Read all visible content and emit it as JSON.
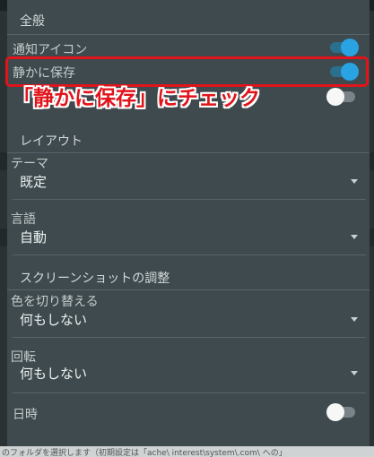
{
  "sections": {
    "general": "全般",
    "layout": "レイアウト",
    "screenshot_adjust": "スクリーンショットの調整"
  },
  "settings": {
    "notification_icon": {
      "label": "通知アイコン",
      "state": "on"
    },
    "silent_save": {
      "label": "静かに保存",
      "state": "on"
    },
    "theme": {
      "label": "テーマ",
      "value": "既定"
    },
    "language": {
      "label": "言語",
      "value": "自動"
    },
    "color_switch": {
      "label": "色を切り替える",
      "value": "何もしない"
    },
    "rotation": {
      "label": "回転",
      "value": "何もしない"
    },
    "datetime": {
      "label": "日時",
      "state": "off"
    }
  },
  "annotation": {
    "callout": "「静かに保存」にチェック"
  },
  "colors": {
    "panel": "#3e4a4e",
    "toggle_on": "#2aa3e3",
    "annotation_red": "#e1141b"
  },
  "background_text": "のフォルダを選択します（初期設定は「ache\\ interest\\system\\.com\\ への」"
}
